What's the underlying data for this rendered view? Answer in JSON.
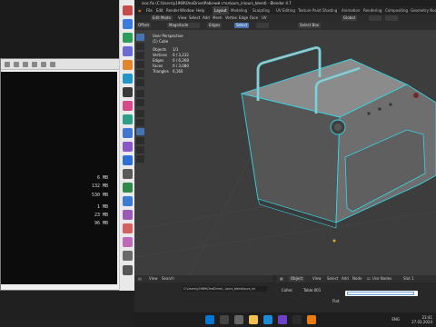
{
  "background_window": {
    "values": [
      "6 MB",
      "132 MB",
      "530 MB",
      "1 MB",
      "23 MB",
      "96 MB"
    ],
    "clock": {
      "time": "23:4",
      "date": "27.03.2024"
    }
  },
  "blender": {
    "title": "isoc.fix (C:\\Users\\y1969\\OneDrive\\Рабочий стол\\ours_in\\ours_blend) - Blender 4.7",
    "menu": [
      "File",
      "Edit",
      "Render",
      "Window",
      "Help"
    ],
    "workspaces": [
      "Layout",
      "Modeling",
      "Sculpting",
      "UV Editing",
      "Texture Paint",
      "Shading",
      "Animation",
      "Rendering",
      "Compositing",
      "Geometry Nodes"
    ],
    "active_workspace": "Layout",
    "header": {
      "mode": "Edit Mode",
      "view": "View",
      "select": "Select",
      "add": "Add",
      "mesh": "Mesh",
      "vertex": "Vertex",
      "edge": "Edge",
      "face": "Face",
      "uv": "UV",
      "orientation": "Global",
      "tool_label": "Offset",
      "tool_mode": "Magnitude",
      "tool_field_1": "Edges",
      "tool_field_2": "Select",
      "tool_field_3": "Select Box"
    },
    "viewport_overlay": {
      "perspective": "User Perspective",
      "object": "(1) Cube",
      "stats": [
        {
          "key": "Objects",
          "value": "1/1"
        },
        {
          "key": "Vertices",
          "value": "0 / 3,232"
        },
        {
          "key": "Edges",
          "value": "0 / 6,268"
        },
        {
          "key": "Faces",
          "value": "0 / 3,080"
        },
        {
          "key": "Triangles",
          "value": "6,160"
        }
      ]
    },
    "file_browser": {
      "view": "View",
      "search": "Search",
      "path": "C:\\Users\\y1969\\OneDrive\\...\\ours_blend\\ours_in\\"
    },
    "outliner": {
      "object": "Object",
      "view": "View",
      "select": "Select",
      "add": "Add",
      "node": "Node",
      "use_nodes": "Use Nodes",
      "slot": "Slot 1",
      "collection": "Collec",
      "row_1": "Table.001",
      "row_2": "Flat",
      "search_value": ""
    }
  },
  "taskbar": {
    "lang": "ENG",
    "time": "23:41",
    "date": "27.03.2024"
  },
  "colors": {
    "accent": "#4772b3",
    "mesh_edge": "#35d6e6",
    "viewport_bg": "#3d3d3d"
  }
}
